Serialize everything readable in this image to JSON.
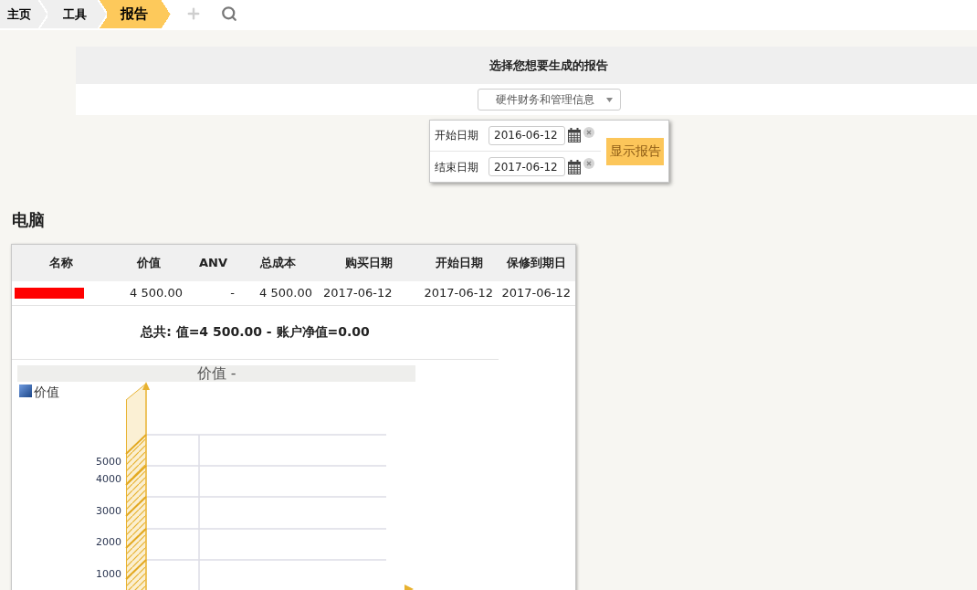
{
  "breadcrumbs": [
    {
      "label": "主页",
      "selected": false
    },
    {
      "label": "工具",
      "selected": false
    },
    {
      "label": "报告",
      "selected": true
    }
  ],
  "report_selector": {
    "title": "选择您想要生成的报告",
    "dropdown": {
      "value": "硬件财务和管理信息"
    }
  },
  "date_filter": {
    "fields": [
      {
        "label": "开始日期",
        "value": "2016-06-12"
      },
      {
        "label": "结束日期",
        "value": "2017-06-12"
      }
    ],
    "button": "显示报告"
  },
  "section": {
    "title": "电脑",
    "table": {
      "columns": [
        "名称",
        "价值",
        "ANV",
        "总成本",
        "购买日期",
        "开始日期",
        "保修到期日"
      ],
      "rows": [
        {
          "cells": [
            {
              "redacted": true
            },
            "4 500.00",
            "-",
            "4 500.00",
            "2017-06-12",
            "2017-06-12",
            "2017-06-12"
          ]
        }
      ]
    },
    "summary": "总共: 值=4 500.00 - 账户净值=0.00",
    "chart": {
      "title": "价值 -",
      "legend": [
        "价值"
      ],
      "y_tick_labels": [
        "5000",
        "4000",
        "3000",
        "2000",
        "1000"
      ]
    }
  }
}
